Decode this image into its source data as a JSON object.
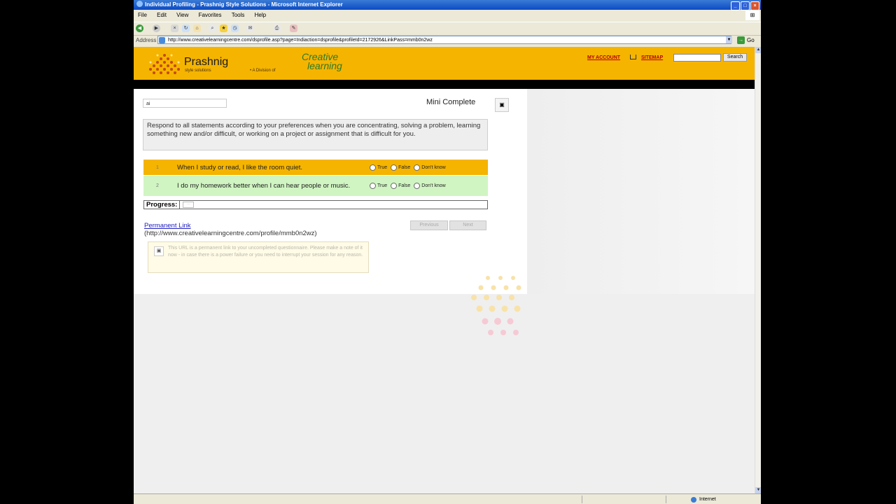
{
  "window": {
    "title": "Individual Profiling - Prashnig Style Solutions - Microsoft Internet Explorer",
    "menu": [
      "File",
      "Edit",
      "View",
      "Favorites",
      "Tools",
      "Help"
    ]
  },
  "address": {
    "label": "Address",
    "url": "http://www.creativelearningcentre.com/dsprofile.asp?page=Indiaction=dsprofile&profileId=2172926&LinkPass=mmb0n2wz",
    "go_label": "Go"
  },
  "header": {
    "brand": "Prashnig",
    "brand_sub": "style solutions",
    "division": "A Division of",
    "partner_line1": "Creative",
    "partner_line2": "learning",
    "my_account": "MY ACCOUNT",
    "sitemap": "SITEMAP",
    "search_placeholder": "",
    "search_button": "Search"
  },
  "form": {
    "code_value": "ai",
    "title": "Mini Complete",
    "instructions": "Respond to all statements according to your preferences when you are concentrating, solving a problem, learning something new and/or difficult, or working on a project or assignment that is difficult for you.",
    "option_labels": [
      "True",
      "False",
      "Don't know"
    ],
    "questions": [
      {
        "number": "1",
        "text": "When I study or read, I like the room quiet."
      },
      {
        "number": "2",
        "text": "I do my homework better when I can hear people or music."
      }
    ],
    "progress_label": "Progress:",
    "progress_fraction": 0.0,
    "permanent_link_label": "Permanent Link",
    "permanent_link_url": "(http://www.creativelearningcentre.com/profile/mmb0n2wz)",
    "previous_button": "Previous",
    "next_button": "Next",
    "note": "This URL is a permanent link to your uncompleted questionnaire. Please make a note of it now - in case there is a power failure or you need to interrupt your session for any reason."
  },
  "status": {
    "zone": "Internet"
  },
  "colors": {
    "header": "#f5b400",
    "row_alt": "#d0f5c2",
    "link": "#2020c0",
    "accent_red": "#b30000"
  }
}
